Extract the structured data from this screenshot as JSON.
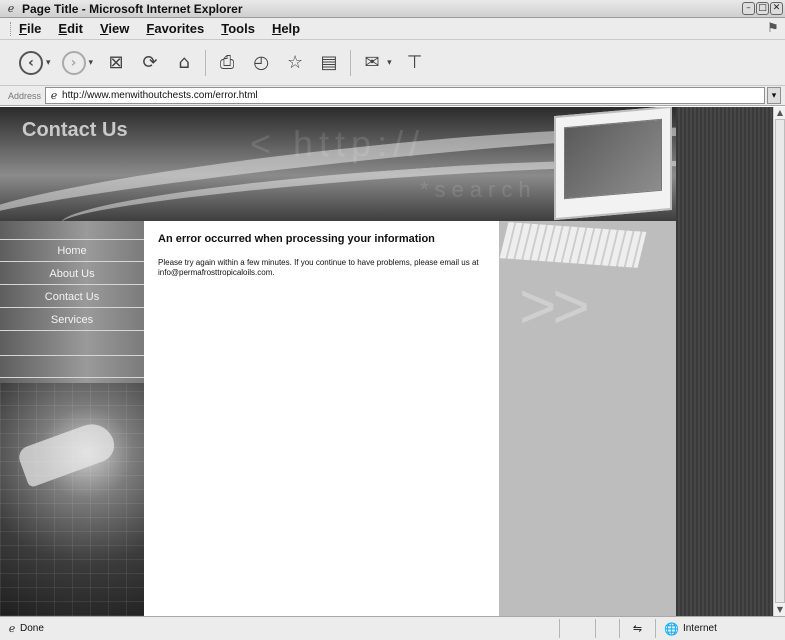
{
  "window": {
    "title": "Page Title - Microsoft Internet Explorer",
    "controls": [
      "minimize",
      "maximize",
      "close"
    ]
  },
  "menu": [
    {
      "label": "File"
    },
    {
      "label": "Edit"
    },
    {
      "label": "View"
    },
    {
      "label": "Favorites"
    },
    {
      "label": "Tools"
    },
    {
      "label": "Help"
    }
  ],
  "toolbar": {
    "icons": [
      "back-icon",
      "forward-icon",
      "stop-icon",
      "refresh-icon",
      "home-icon",
      "print-icon",
      "history-icon",
      "favorites-icon",
      "research-icon",
      "mail-icon",
      "discuss-icon"
    ]
  },
  "address": {
    "label": "Address",
    "url": "http://www.menwithoutchests.com/error.html"
  },
  "site": {
    "banner_heading": "Contact Us",
    "nav": [
      {
        "label": "Home"
      },
      {
        "label": "About Us"
      },
      {
        "label": "Contact Us"
      },
      {
        "label": "Services"
      }
    ],
    "error_heading": "An error occurred when processing your information",
    "error_message": "Please try again within a few minutes. If you continue to have problems, please email us at info@permafrosttropicaloils.com."
  },
  "status": {
    "text": "Done",
    "zone": "Internet"
  }
}
